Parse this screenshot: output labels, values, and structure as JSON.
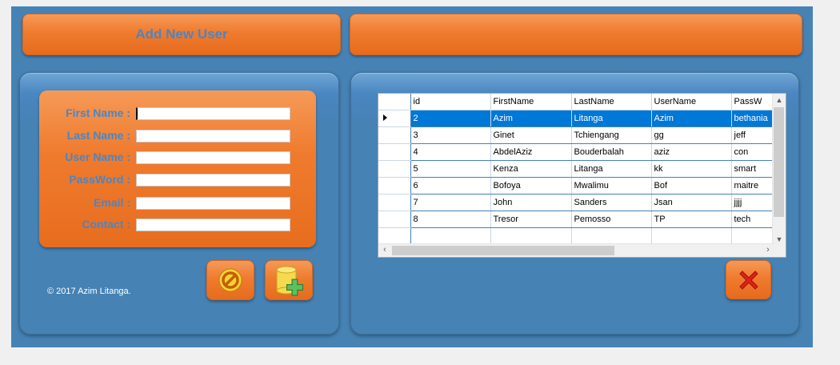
{
  "header": {
    "title": "Add New User",
    "right_title": ""
  },
  "form": {
    "fields": [
      {
        "label": "First Name :",
        "value": ""
      },
      {
        "label": "Last Name :",
        "value": ""
      },
      {
        "label": "User Name :",
        "value": ""
      },
      {
        "label": "PassWord :",
        "value": ""
      },
      {
        "label": "Email :",
        "value": ""
      },
      {
        "label": "Contact :",
        "value": ""
      }
    ]
  },
  "buttons": {
    "cancel_icon": "cancel-icon",
    "add_icon": "database-add-icon",
    "close_icon": "close-x-icon"
  },
  "footer": {
    "copyright": "© 2017 Azim Litanga."
  },
  "grid": {
    "columns": [
      "id",
      "FirstName",
      "LastName",
      "UserName",
      "PassW"
    ],
    "selected_row": 0,
    "rows": [
      [
        "2",
        "Azim",
        "Litanga",
        "Azim",
        "bethania"
      ],
      [
        "3",
        "Ginet",
        "Tchiengang",
        "gg",
        "jeff"
      ],
      [
        "4",
        "AbdelAziz",
        "Bouderbalah",
        "aziz",
        "con"
      ],
      [
        "5",
        "Kenza",
        "Litanga",
        "kk",
        "smart"
      ],
      [
        "6",
        "Bofoya",
        "Mwalimu",
        "Bof",
        "maitre"
      ],
      [
        "7",
        "John",
        "Sanders",
        "Jsan",
        "jjjj"
      ],
      [
        "8",
        "Tresor",
        "Pemosso",
        "TP",
        "tech"
      ]
    ]
  },
  "colors": {
    "background": "#4682b4",
    "accent_orange": "#ef7b2e",
    "label_blue": "#4a86c4",
    "selection": "#0078d7"
  }
}
